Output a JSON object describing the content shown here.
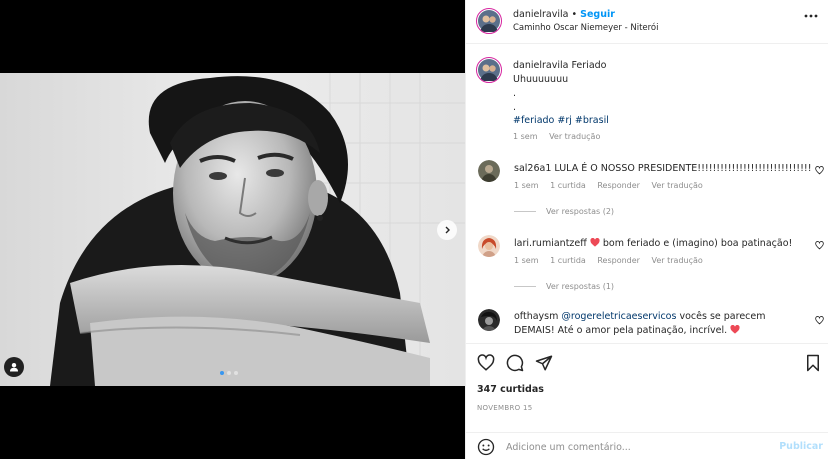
{
  "post": {
    "username": "danielravila",
    "follow_label": "Seguir",
    "separator": "•",
    "location": "Caminho Oscar Niemeyer - Niterói"
  },
  "caption": {
    "username": "danielravila",
    "text_line1": "Feriado",
    "text_line2": "Uhuuuuuuu",
    "text_line3": ".",
    "text_line4": ".",
    "hashtags": "#feriado #rj #brasil",
    "time": "1 sem",
    "translate": "Ver tradução"
  },
  "comments": [
    {
      "username": "sal26a1",
      "text": "LULA É O NOSSO PRESIDENTE!!!!!!!!!!!!!!!!!!!!!!!!!!!!!!",
      "time": "1 sem",
      "likes": "1 curtida",
      "reply": "Responder",
      "translate": "Ver tradução",
      "view_replies": "Ver respostas (2)"
    },
    {
      "username": "lari.rumiantzeff",
      "text": "bom feriado e (imagino) boa patinação!",
      "time": "1 sem",
      "likes": "1 curtida",
      "reply": "Responder",
      "translate": "Ver tradução",
      "view_replies": "Ver respostas (1)"
    },
    {
      "username": "ofthaysm",
      "mention": "@rogereletricaeservicos",
      "text_line1": "vocês se parecem",
      "text_line2": "DEMAIS! Até o amor pela patinação, incrível."
    }
  ],
  "actions": {
    "likes": "347 curtidas",
    "date": "NOVEMBRO 15"
  },
  "comment_box": {
    "placeholder": "Adicione um comentário...",
    "publish": "Publicar"
  },
  "colors": {
    "accent": "#0095f6",
    "heart_red": "#ed4956",
    "hashtag": "#00376b",
    "secondary_text": "#8e8e8e"
  },
  "carousel": {
    "current_slide": 1,
    "total_slides": 3
  },
  "icons": [
    "more-icon",
    "heart-icon",
    "comment-icon",
    "share-icon",
    "bookmark-icon",
    "emoji-icon",
    "chevron-right-icon",
    "user-tag-icon"
  ]
}
